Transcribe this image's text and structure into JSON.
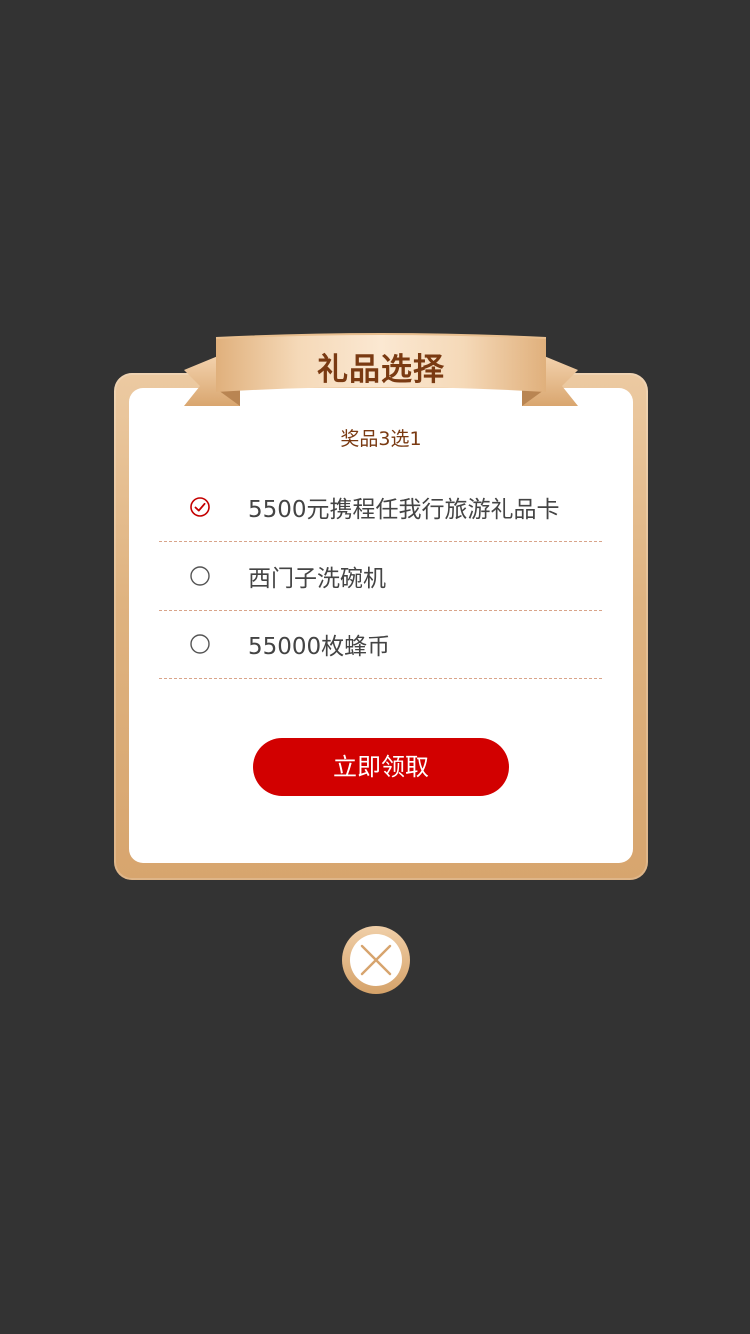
{
  "dialog": {
    "title": "礼品选择",
    "subtitle": "奖品3选1",
    "options": [
      {
        "label": "5500元携程任我行旅游礼品卡",
        "selected": true
      },
      {
        "label": "西门子洗碗机",
        "selected": false
      },
      {
        "label": "55000枚蜂币",
        "selected": false
      }
    ],
    "claim_label": "立即领取",
    "close_icon": "close-icon"
  },
  "colors": {
    "backdrop": "#333333",
    "frame_gold": "#dfb380",
    "title_brown": "#7a3a12",
    "button_red": "#d20000",
    "selected_red": "#c40000",
    "divider": "#d9a48a"
  }
}
